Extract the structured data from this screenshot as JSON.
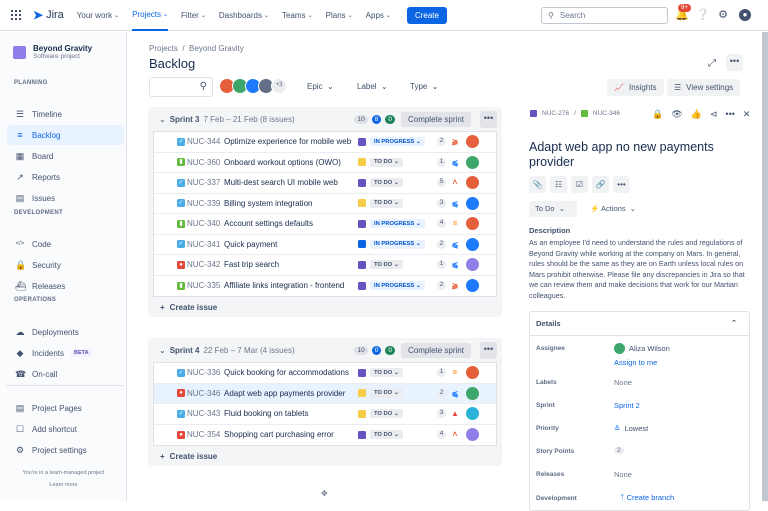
{
  "topnav": {
    "product": "Jira",
    "items": [
      {
        "label": "Your work",
        "active": false
      },
      {
        "label": "Projects",
        "active": true
      },
      {
        "label": "Filter",
        "active": false
      },
      {
        "label": "Dashboards",
        "active": false
      },
      {
        "label": "Teams",
        "active": false
      },
      {
        "label": "Plans",
        "active": false
      },
      {
        "label": "Apps",
        "active": false
      }
    ],
    "create_label": "Create",
    "search_placeholder": "Search",
    "notifications_count": "9+"
  },
  "sidebar": {
    "project_name": "Beyond Gravity",
    "project_type": "Software project",
    "sections": {
      "planning": "PLANNING",
      "development": "DEVELOPMENT",
      "operations": "OPERATIONS"
    },
    "planning": [
      {
        "label": "Timeline",
        "icon": "timeline-icon"
      },
      {
        "label": "Backlog",
        "icon": "backlog-icon",
        "active": true
      },
      {
        "label": "Board",
        "icon": "board-icon"
      },
      {
        "label": "Reports",
        "icon": "reports-icon"
      },
      {
        "label": "Issues",
        "icon": "issues-icon"
      }
    ],
    "development": [
      {
        "label": "Code",
        "icon": "code-icon"
      },
      {
        "label": "Security",
        "icon": "lock-icon"
      },
      {
        "label": "Releases",
        "icon": "releases-icon"
      }
    ],
    "operations": [
      {
        "label": "Deployments",
        "icon": "cloud-icon"
      },
      {
        "label": "Incidents",
        "icon": "incident-icon",
        "badge": "BETA"
      },
      {
        "label": "On-call",
        "icon": "phone-icon"
      }
    ],
    "extra": [
      {
        "label": "Project Pages",
        "icon": "pages-icon"
      },
      {
        "label": "Add shortcut",
        "icon": "add-shortcut-icon"
      },
      {
        "label": "Project settings",
        "icon": "gear-icon"
      }
    ],
    "footer_text": "You're in a team-managed project",
    "footer_link": "Learn more"
  },
  "main": {
    "breadcrumb": [
      "Projects",
      "Beyond Gravity"
    ],
    "title": "Backlog",
    "avatars_more": "+3",
    "filters": [
      "Epic",
      "Label",
      "Type"
    ],
    "insights_label": "Insights",
    "view_settings_label": "View settings",
    "create_issue_label": "Create issue",
    "complete_sprint_label": "Complete sprint"
  },
  "colors": {
    "accent": "#0c66e4",
    "epic_purple": "#6554c0",
    "epic_yellow": "#f5cd47",
    "epic_blue": "#0c66e4"
  },
  "sprints": [
    {
      "name": "Sprint 3",
      "dates": "7 Feb – 21 Feb (8 issues)",
      "counts": [
        "10",
        "8",
        "0"
      ],
      "issues": [
        {
          "type": "task",
          "key": "NUC-344",
          "summary": "Optimize experience for mobile web",
          "epic": "#6554c0",
          "status": "IN PROGRESS",
          "points": "2",
          "priority": "highest",
          "avatar": "#e5603a"
        },
        {
          "type": "story",
          "key": "NUC-360",
          "summary": "Onboard workout options (OWO)",
          "epic": "#f5cd47",
          "status": "TO DO",
          "points": "1",
          "priority": "lowest",
          "avatar": "#3fa66b"
        },
        {
          "type": "task",
          "key": "NUC-337",
          "summary": "Multi-dest search UI mobile web",
          "epic": "#6554c0",
          "status": "TO DO",
          "points": "5",
          "priority": "high",
          "avatar": "#e5603a"
        },
        {
          "type": "task",
          "key": "NUC-339",
          "summary": "Billing system integration",
          "epic": "#f5cd47",
          "status": "TO DO",
          "points": "3",
          "priority": "lowest",
          "avatar": "#1d7afc"
        },
        {
          "type": "story",
          "key": "NUC-340",
          "summary": "Account settings defaults",
          "epic": "#6554c0",
          "status": "IN PROGRESS",
          "points": "4",
          "priority": "medium",
          "avatar": "#e5603a"
        },
        {
          "type": "task",
          "key": "NUC-341",
          "summary": "Quick payment",
          "epic": "#0c66e4",
          "status": "IN PROGRESS",
          "points": "2",
          "priority": "lowest",
          "avatar": "#1d7afc"
        },
        {
          "type": "bug",
          "key": "NUC-342",
          "summary": "Fast trip search",
          "epic": "#6554c0",
          "status": "TO DO",
          "points": "1",
          "priority": "lowest",
          "avatar": "#8f7ee7"
        },
        {
          "type": "story",
          "key": "NUC-335",
          "summary": "Affiliate links integration - frontend",
          "epic": "#6554c0",
          "status": "IN PROGRESS",
          "points": "2",
          "priority": "highest",
          "avatar": "#1d7afc"
        }
      ]
    },
    {
      "name": "Sprint 4",
      "dates": "22 Feb – 7 Mar (4 issues)",
      "counts": [
        "10",
        "0",
        "0"
      ],
      "issues": [
        {
          "type": "task",
          "key": "NUC-336",
          "summary": "Quick booking for accommodations",
          "epic": "#6554c0",
          "status": "TO DO",
          "points": "1",
          "priority": "medium",
          "avatar": "#e5603a"
        },
        {
          "type": "bug",
          "key": "NUC-346",
          "summary": "Adapt web app payments provider",
          "epic": "#f5cd47",
          "status": "TO DO",
          "points": "2",
          "priority": "lowest",
          "avatar": "#3fa66b",
          "selected": true
        },
        {
          "type": "task",
          "key": "NUC-343",
          "summary": "Fluid booking on tablets",
          "epic": "#f5cd47",
          "status": "TO DO",
          "points": "3",
          "priority": "blocker",
          "avatar": "#2ab3d9"
        },
        {
          "type": "bug",
          "key": "NUC-354",
          "summary": "Shopping cart purchasing error",
          "epic": "#6554c0",
          "status": "TO DO",
          "points": "4",
          "priority": "high",
          "avatar": "#8f7ee7"
        }
      ]
    }
  ],
  "panel": {
    "parent_key": "NUC-276",
    "issue_key": "NUC-346",
    "title": "Adapt web app no new payments provider",
    "status": "To Do",
    "actions_label": "Actions",
    "description_heading": "Description",
    "description": "As an employee I'd need to understand the rules and regulations of Beyond Gravity while working at the company on Mars. In general, rules should be the same as they are on Earth unless local rules on Mars prohibit otherwise. Please file any discrepancies in Jira so that we can review them and make decisions that work for our Martian colleagues.",
    "details_heading": "Details",
    "fields": {
      "assignee_label": "Assignee",
      "assignee": "Aliza Wilson",
      "assign_to_me": "Assign to me",
      "labels_label": "Labels",
      "labels": "None",
      "sprint_label": "Sprint",
      "sprint": "Sprint 2",
      "priority_label": "Priority",
      "priority": "Lowest",
      "story_points_label": "Story Points",
      "story_points": "2",
      "releases_label": "Releases",
      "releases": "None",
      "development_label": "Development",
      "development": "Create branch"
    }
  }
}
